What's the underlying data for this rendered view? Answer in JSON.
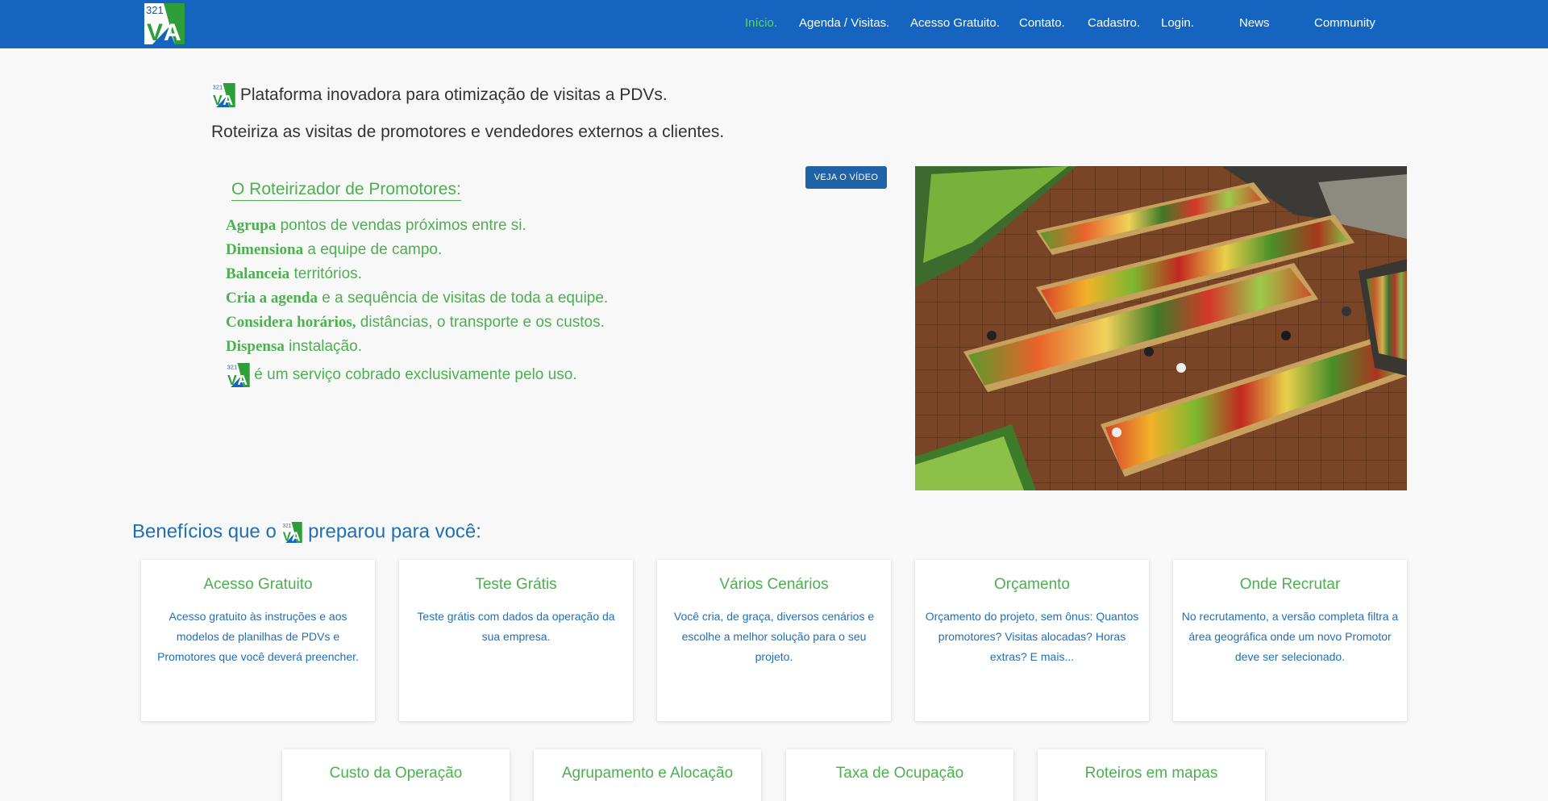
{
  "nav": {
    "items": [
      {
        "label": "Início.",
        "active": true
      },
      {
        "label": "Agenda / Visitas."
      },
      {
        "label": "Acesso Gratuito."
      },
      {
        "label": "Contato."
      },
      {
        "label": "Cadastro."
      },
      {
        "label": "Login."
      },
      {
        "label": "News"
      },
      {
        "label": "Community"
      }
    ]
  },
  "logo": {
    "digits": "321",
    "letters": "VA"
  },
  "intro": {
    "headline": "Plataforma inovadora para otimização de visitas a PDVs.",
    "subline": "Roteiriza as visitas de promotores e vendedores externos a clientes."
  },
  "roteirizador": {
    "title": "O Roteirizador de Promotores:",
    "video_button": "VEJA O VÍDEO",
    "features": [
      {
        "bold": "Agrupa",
        "text": " pontos de vendas próximos entre si."
      },
      {
        "bold": "Dimensiona",
        "text": " a equipe de campo."
      },
      {
        "bold": "Balanceia",
        "text": " territórios."
      },
      {
        "bold": "Cria a agenda",
        "text": " e a sequência de visitas de toda a equipe."
      },
      {
        "bold": "Considera horários,",
        "text": " distâncias, o transporte e os custos."
      },
      {
        "bold": "Dispensa",
        "text": " instalação."
      }
    ],
    "footer_note": "é um serviço cobrado exclusivamente pelo uso."
  },
  "benefits": {
    "title_before": "Benefícios que o",
    "title_after": "preparou para você:",
    "cards": [
      {
        "title": "Acesso Gratuito",
        "text": "Acesso gratuito às instruções e aos modelos de planilhas de PDVs e Promotores que você deverá preencher."
      },
      {
        "title": "Teste Grátis",
        "text": "Teste grátis com dados da operação da sua empresa."
      },
      {
        "title": "Vários Cenários",
        "text": "Você cria, de graça, diversos cenários e escolhe a melhor solução para o seu projeto."
      },
      {
        "title": "Orçamento",
        "text": "Orçamento do projeto, sem ônus: Quantos promotores? Visitas alocadas? Horas extras? E mais..."
      },
      {
        "title": "Onde Recrutar",
        "text": "No recrutamento, a versão completa filtra a área geográfica onde um novo Promotor deve ser selecionado."
      }
    ],
    "cards_row2": [
      {
        "title": "Custo da Operação"
      },
      {
        "title": "Agrupamento e Alocação"
      },
      {
        "title": "Taxa de Ocupação"
      },
      {
        "title": "Roteiros em mapas"
      }
    ]
  },
  "colors": {
    "navbar": "#1565c0",
    "accent_green": "#4caf50",
    "accent_blue": "#1f6fb5"
  }
}
